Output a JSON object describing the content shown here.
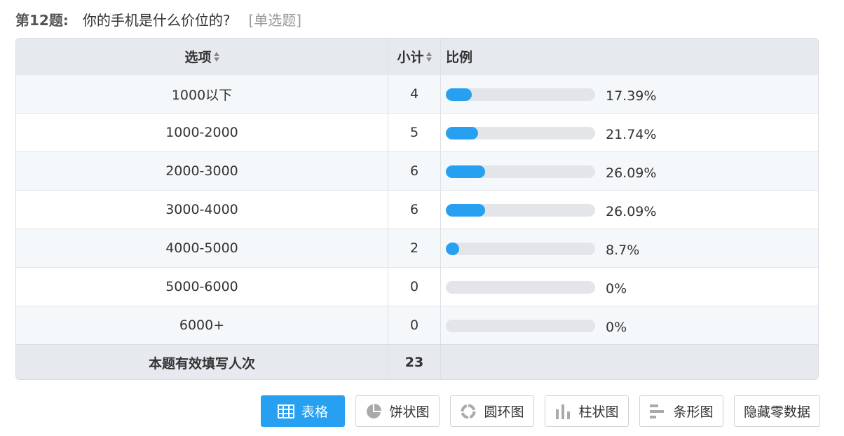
{
  "question": {
    "number": "第12题:",
    "text": "你的手机是什么价位的?",
    "type": "[单选题]"
  },
  "table": {
    "headers": {
      "option": "选项",
      "count": "小计",
      "ratio": "比例"
    },
    "rows": [
      {
        "option": "1000以下",
        "count": "4",
        "percent": "17.39%",
        "fraction": 0.1739
      },
      {
        "option": "1000-2000",
        "count": "5",
        "percent": "21.74%",
        "fraction": 0.2174
      },
      {
        "option": "2000-3000",
        "count": "6",
        "percent": "26.09%",
        "fraction": 0.2609
      },
      {
        "option": "3000-4000",
        "count": "6",
        "percent": "26.09%",
        "fraction": 0.2609
      },
      {
        "option": "4000-5000",
        "count": "2",
        "percent": "8.7%",
        "fraction": 0.087
      },
      {
        "option": "5000-6000",
        "count": "0",
        "percent": "0%",
        "fraction": 0
      },
      {
        "option": "6000+",
        "count": "0",
        "percent": "0%",
        "fraction": 0
      }
    ],
    "footer": {
      "label": "本题有效填写人次",
      "total": "23"
    }
  },
  "buttons": {
    "table": "表格",
    "pie": "饼状图",
    "donut": "圆环图",
    "column": "柱状图",
    "bar": "条形图",
    "hide_zero": "隐藏零数据"
  },
  "colors": {
    "accent": "#27a0f2",
    "track": "#e3e5e8",
    "header_bg": "#e6e9ee"
  }
}
